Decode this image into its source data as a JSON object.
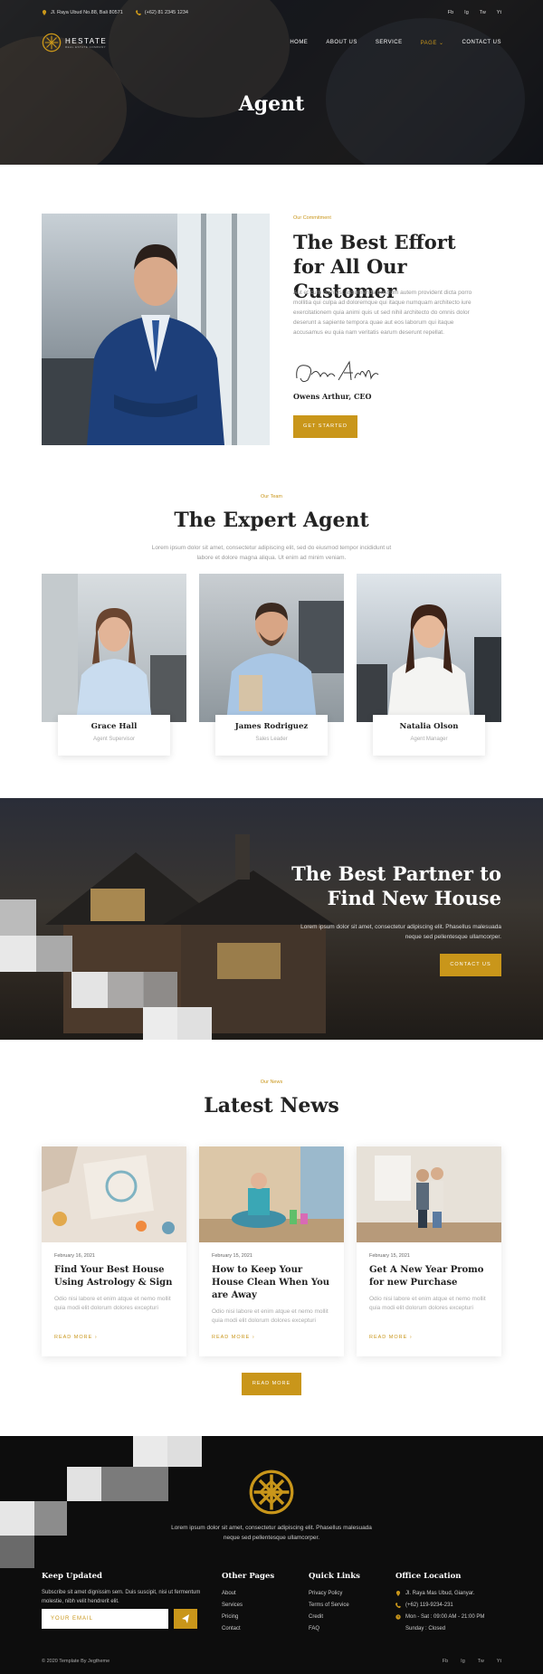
{
  "topbar": {
    "address": "Jl. Raya Ubud No.88, Bali 80571",
    "phone": "(+62) 81 2345 1234",
    "social": [
      "Fb",
      "Ig",
      "Tw",
      "Yt"
    ]
  },
  "brand": {
    "name": "HESTATE",
    "tagline": "REAL ESTATE COMPANY"
  },
  "nav": [
    {
      "label": "HOME"
    },
    {
      "label": "ABOUT US"
    },
    {
      "label": "SERVICE"
    },
    {
      "label": "PAGE"
    },
    {
      "label": "CONTACT US"
    }
  ],
  "hero": {
    "title": "Agent"
  },
  "about": {
    "eyebrow": "Our Commitment",
    "title": "The Best Effort for All Our Customer",
    "body": "Aut et cum cum est assumenda nostrum autem provident dicta porro mollitia qui culpa ad doloremque qui itaque numquam architecto iure exercitationem quia animi quis ut sed nihil architecto do omnis dolor deserunt a sapiente tempora quae aut eos laborum qui itaque accusamus eu quia nam veritatis earum deserunt repellat.",
    "signature": "Owens Arthur",
    "ceo": "Owens Arthur, CEO",
    "button": "GET STARTED"
  },
  "team": {
    "eyebrow": "Our Team",
    "title": "The Expert Agent",
    "subtitle": "Lorem ipsum dolor sit amet, consectetur adipiscing elit, sed do eiusmod tempor incididunt ut labore et dolore magna aliqua. Ut enim ad minim veniam.",
    "members": [
      {
        "name": "Grace Hall",
        "role": "Agent Supervisor"
      },
      {
        "name": "James Rodriguez",
        "role": "Sales Leader"
      },
      {
        "name": "Natalia Olson",
        "role": "Agent Manager"
      }
    ]
  },
  "partner": {
    "title": "The Best Partner to Find New House",
    "body": "Lorem ipsum dolor sit amet, consectetur adipiscing elit. Phasellus malesuada neque sed pellentesque ullamcorper.",
    "button": "CONTACT US"
  },
  "news": {
    "eyebrow": "Our News",
    "title": "Latest News",
    "items": [
      {
        "date": "February 16, 2021",
        "title": "Find Your Best House Using Astrology & Sign",
        "desc": "Odio nisi labore et enim atque et nemo mollit quia modi elit dolorum dolores excepturi",
        "more": "READ MORE"
      },
      {
        "date": "February 15, 2021",
        "title": "How to Keep Your House Clean When You are Away",
        "desc": "Odio nisi labore et enim atque et nemo mollit quia modi elit dolorum dolores excepturi",
        "more": "READ MORE"
      },
      {
        "date": "February 15, 2021",
        "title": "Get A New Year Promo for new Purchase",
        "desc": "Odio nisi labore et enim atque et nemo mollit quia modi elit dolorum dolores excepturi",
        "more": "READ MORE"
      }
    ],
    "button": "READ MORE"
  },
  "footer": {
    "tagline": "Lorem ipsum dolor sit amet, consectetur adipiscing elit. Phasellus malesuada neque sed pellentesque ullamcorper.",
    "keep_updated": {
      "title": "Keep Updated",
      "body": "Subscribe sit amet dignissim sem. Duis suscipit, nisi ut fermentum molestie, nibh velit hendrerit elit.",
      "placeholder": "YOUR EMAIL"
    },
    "other_pages": {
      "title": "Other Pages",
      "links": [
        "About",
        "Services",
        "Pricing",
        "Contact"
      ]
    },
    "quick_links": {
      "title": "Quick Links",
      "links": [
        "Privacy Policy",
        "Terms of Service",
        "Credit",
        "FAQ"
      ]
    },
    "office": {
      "title": "Office Location",
      "address": "Jl. Raya Mas Ubud, Gianyar.",
      "phone": "(+62) 119-9234-231",
      "hours": "Mon - Sat : 09:00 AM - 21:00 PM Sunday : Closed"
    },
    "copyright": "© 2020 Template By Jegtheme",
    "social": [
      "Fb",
      "Ig",
      "Tw",
      "Yt"
    ]
  },
  "colors": {
    "accent": "#c9961a",
    "dark": "#0d0d0d"
  }
}
